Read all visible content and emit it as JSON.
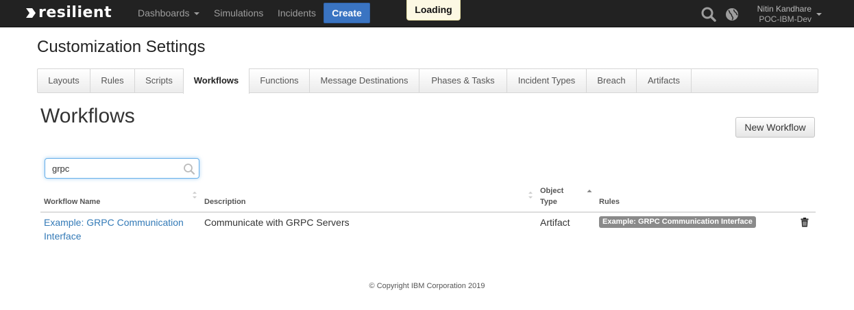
{
  "nav": {
    "brand": "resilient",
    "dashboards": "Dashboards",
    "simulations": "Simulations",
    "incidents": "Incidents",
    "create": "Create",
    "loading": "Loading",
    "user_name": "Nitin Kandhare",
    "org_name": "POC-IBM-Dev"
  },
  "page": {
    "title": "Customization Settings"
  },
  "tabs": [
    {
      "label": "Layouts"
    },
    {
      "label": "Rules"
    },
    {
      "label": "Scripts"
    },
    {
      "label": "Workflows",
      "active": true
    },
    {
      "label": "Functions"
    },
    {
      "label": "Message Destinations"
    },
    {
      "label": "Phases & Tasks"
    },
    {
      "label": "Incident Types"
    },
    {
      "label": "Breach"
    },
    {
      "label": "Artifacts"
    }
  ],
  "workflows": {
    "title": "Workflows",
    "new_button": "New Workflow",
    "search_value": "grpc",
    "columns": {
      "name": "Workflow Name",
      "description": "Description",
      "object_type_1": "Object",
      "object_type_2": "Type",
      "rules": "Rules"
    },
    "rows": [
      {
        "name_line1": "Example: GRPC Communication",
        "name_line2": "Interface",
        "description": "Communicate with GRPC Servers",
        "object_type": "Artifact",
        "rule": "Example: GRPC Communication Interface"
      }
    ]
  },
  "footer": {
    "copyright": "© Copyright IBM Corporation 2019"
  },
  "colors": {
    "topbar": "#222222",
    "create_button": "#3a74c2",
    "link": "#337ab7",
    "badge": "#8a8a8a"
  }
}
